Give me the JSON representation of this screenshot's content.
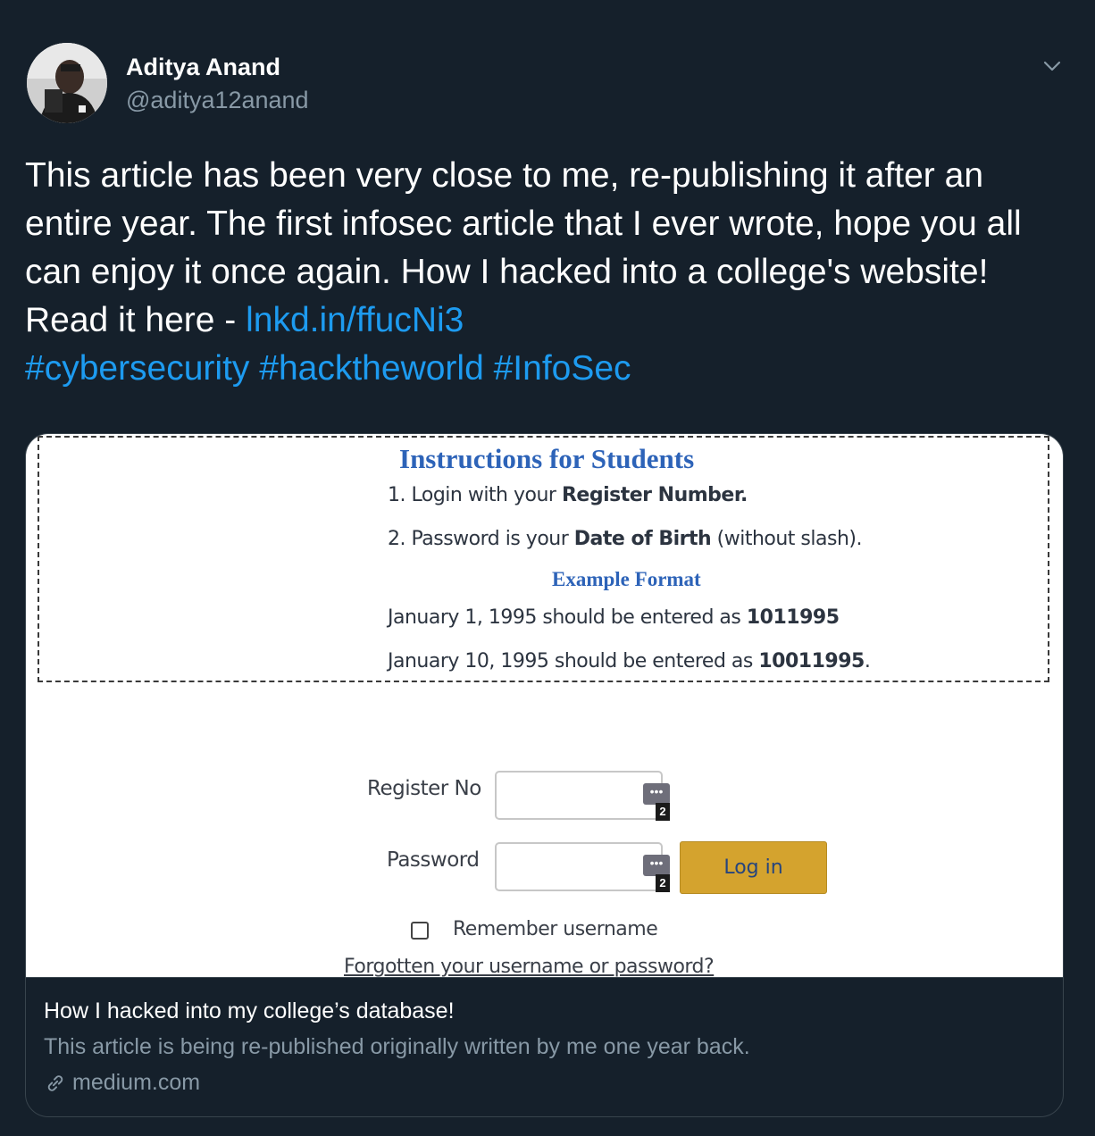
{
  "tweet": {
    "author_name": "Aditya Anand",
    "author_handle": "@aditya12anand",
    "text_part1": "This article has been very close to me, re-publishing it after an entire year. The first infosec article that I ever wrote, hope you all can enjoy it once again. How I hacked into a college's website!",
    "text_part2": "Read it here - ",
    "link": "lnkd.in/ffucNi3",
    "hashtags": [
      "#cybersecurity",
      "#hacktheworld",
      "#InfoSec"
    ]
  },
  "card": {
    "image": {
      "instructions_title": "Instructions for Students",
      "line1_pre": "1. Login with your ",
      "line1_bold": "Register Number.",
      "line2_pre": "2. Password is your ",
      "line2_bold": "Date of Birth",
      "line2_post": " (without slash).",
      "example_title": "Example Format",
      "example1_pre": "January 1, 1995 should be entered as ",
      "example1_bold": "1011995",
      "example2_pre": "January 10, 1995 should be entered as ",
      "example2_bold": "10011995",
      "example2_post": ".",
      "register_label": "Register No",
      "password_label": "Password",
      "pw_manager_badge": "2",
      "login_button": "Log in",
      "remember_label": "Remember username",
      "forgot_link": "Forgotten your username or password?"
    },
    "title": "How I hacked into my college’s database!",
    "description": "This article is being re-published originally written by me one year back.",
    "domain": "medium.com"
  },
  "colors": {
    "background": "#15202b",
    "link": "#1d9bf0",
    "muted": "#8899a6",
    "login_button": "#d4a32e",
    "instructions_title": "#2d63b8"
  },
  "icons": [
    "avatar",
    "chevron-down-icon",
    "password-manager-icon",
    "link-icon"
  ]
}
